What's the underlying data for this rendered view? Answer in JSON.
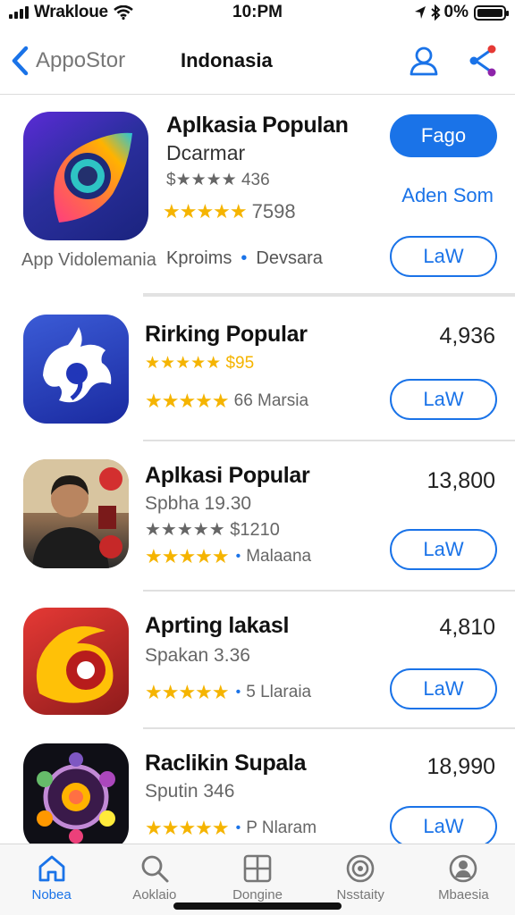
{
  "status": {
    "carrier": "Wrakloue",
    "time": "10:PM",
    "battery": "0%",
    "battery_level": 1.0
  },
  "nav": {
    "back_label": "AppoStor",
    "title": "Indonasia"
  },
  "featured": {
    "name": "Aplkasia Populan",
    "subtitle": "Dcarmar",
    "rating_line_1": "$★★★★ 436",
    "stars": "★★★★★",
    "rating_count": "7598",
    "caption": "App Vidolemania",
    "meta_a": "Kproims",
    "meta_b": "Devsara",
    "primary_button": "Fago",
    "secondary_link": "Aden Som",
    "action_button": "LaW"
  },
  "apps": [
    {
      "name": "Rirking Popular",
      "subtitle": "★★★★★ $95",
      "stars": "★★★★★",
      "meta": "66 Marsia",
      "count": "4,936",
      "button": "LaW"
    },
    {
      "name": "Aplkasi Popular",
      "subtitle": "Spbha 19.30",
      "sub2": "★★★★★ $1210",
      "stars": "★★★★★",
      "meta": "Malaana",
      "count": "13,800",
      "button": "LaW"
    },
    {
      "name": "Aprting lakasl",
      "subtitle": "Spakan 3.36",
      "stars": "★★★★★",
      "meta": "5 Llaraia",
      "count": "4,810",
      "button": "LaW"
    },
    {
      "name": "Raclikin Supala",
      "subtitle": "Sputin 346",
      "stars": "★★★★★",
      "meta": "P Nlaram",
      "count": "18,990",
      "button": "LaW"
    }
  ],
  "tabs": [
    {
      "label": "Nobea",
      "icon": "home-icon",
      "active": true
    },
    {
      "label": "Aoklaio",
      "icon": "search-icon",
      "active": false
    },
    {
      "label": "Dongine",
      "icon": "grid-icon",
      "active": false
    },
    {
      "label": "Nsstaity",
      "icon": "target-icon",
      "active": false
    },
    {
      "label": "Mbaesia",
      "icon": "profile-icon",
      "active": false
    }
  ],
  "colors": {
    "accent": "#1a73e8",
    "star": "#f5b400"
  }
}
